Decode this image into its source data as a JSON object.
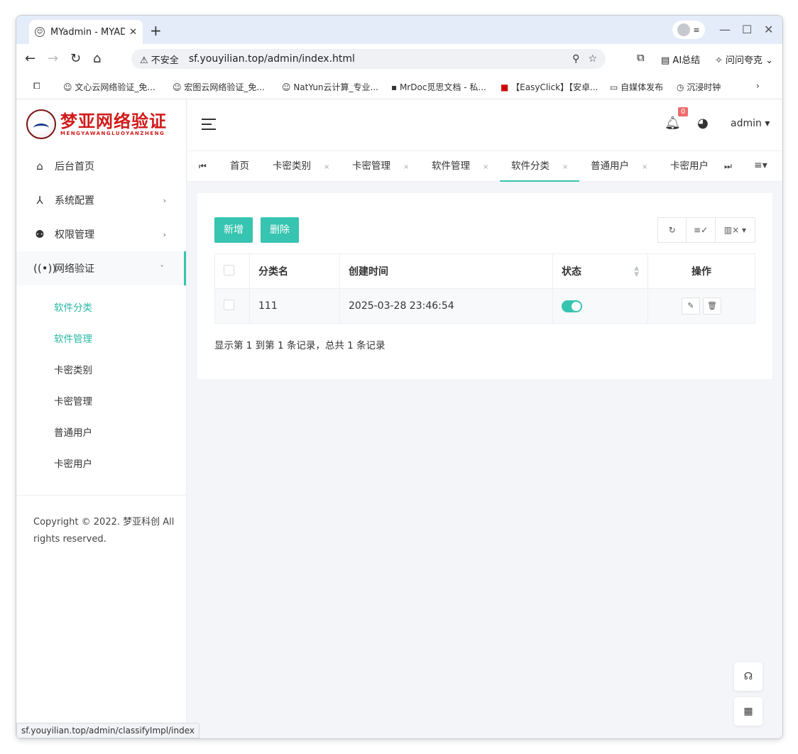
{
  "browser": {
    "tab_title": "MYadmin - MYAD",
    "url_warning": "不安全",
    "url": "sf.youyilian.top/admin/index.html",
    "ai_summary": "AI总结",
    "ask": "问问夸克",
    "bookmarks": [
      "文心云网络验证_免...",
      "宏图云网络验证_免...",
      "NatYun云计算_专业...",
      "MrDoc觅思文档 - 私...",
      "【EasyClick】【安卓...",
      "自媒体发布",
      "沉浸时钟"
    ],
    "status_url": "sf.youyilian.top/admin/classifyImpl/index"
  },
  "logo": {
    "cn": "梦亚网络验证",
    "en": "MENGYAWANGLUOYANZHENG"
  },
  "sidebar": {
    "items": [
      {
        "label": "后台首页",
        "icon": "home-icon"
      },
      {
        "label": "系统配置",
        "icon": "compass-icon"
      },
      {
        "label": "权限管理",
        "icon": "permission-icon"
      },
      {
        "label": "网络验证",
        "icon": "broadcast-icon"
      }
    ],
    "subitems": [
      "软件分类",
      "软件管理",
      "卡密类别",
      "卡密管理",
      "普通用户",
      "卡密用户"
    ],
    "copyright": "Copyright © 2022. 梦亚科创 All rights reserved."
  },
  "topbar": {
    "badge": "0",
    "user": "admin"
  },
  "tabs": [
    "首页",
    "卡密类别",
    "卡密管理",
    "软件管理",
    "软件分类",
    "普通用户",
    "卡密用户"
  ],
  "toolbar": {
    "add": "新增",
    "delete": "删除"
  },
  "table": {
    "headers": [
      "分类名",
      "创建时间",
      "状态",
      "操作"
    ],
    "rows": [
      {
        "name": "111",
        "created": "2025-03-28 23:46:54",
        "status": "on"
      }
    ]
  },
  "pagination": "显示第 1 到第 1 条记录，总共 1 条记录",
  "colors": {
    "accent": "#37c4b0",
    "badge": "#ee6b6b"
  }
}
